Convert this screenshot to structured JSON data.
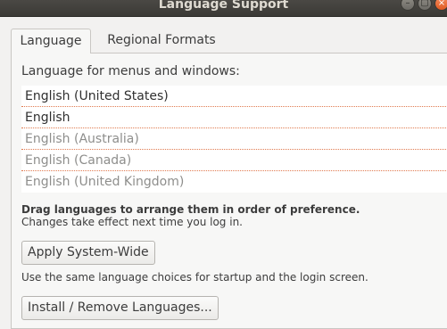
{
  "window": {
    "title": "Language Support",
    "controls": {
      "minimize_icon": "–",
      "maximize_icon": "▢",
      "close_icon": "×"
    }
  },
  "tabs": [
    {
      "label": "Language",
      "active": true
    },
    {
      "label": "Regional Formats",
      "active": false
    }
  ],
  "language_section": {
    "heading": "Language for menus and windows:",
    "languages": [
      {
        "label": "English (United States)",
        "state": "active"
      },
      {
        "label": "English",
        "state": "active"
      },
      {
        "label": "English (Australia)",
        "state": "dimmed"
      },
      {
        "label": "English (Canada)",
        "state": "dimmed"
      },
      {
        "label": "English (United Kingdom)",
        "state": "dimmed"
      }
    ],
    "drag_hint": "Drag languages to arrange them in order of preference.",
    "effect_hint": "Changes take effect next time you log in.",
    "apply_button": "Apply System-Wide",
    "apply_note": "Use the same language choices for startup and the login screen.",
    "install_button": "Install / Remove Languages..."
  }
}
